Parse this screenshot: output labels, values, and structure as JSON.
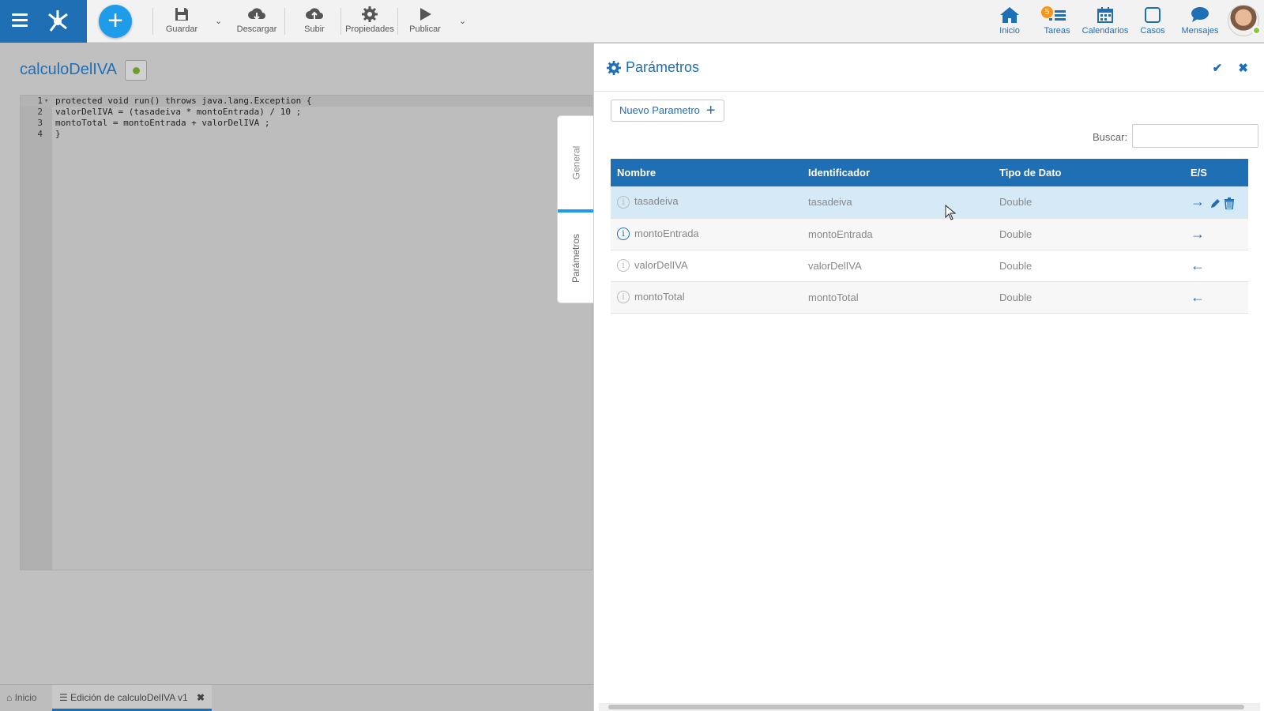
{
  "toolbar": {
    "buttons": [
      {
        "label": "Guardar",
        "icon": "save-icon"
      },
      {
        "label": "Descargar",
        "icon": "cloud-download-icon"
      },
      {
        "label": "Subir",
        "icon": "cloud-upload-icon"
      },
      {
        "label": "Propiedades",
        "icon": "gear-icon"
      },
      {
        "label": "Publicar",
        "icon": "play-icon"
      }
    ],
    "add_label": "+"
  },
  "nav": {
    "items": [
      {
        "label": "Inicio",
        "icon": "home-icon"
      },
      {
        "label": "Tareas",
        "icon": "tasks-icon",
        "badge": "5"
      },
      {
        "label": "Calendarios",
        "icon": "calendar-icon"
      },
      {
        "label": "Casos",
        "icon": "case-icon"
      },
      {
        "label": "Mensajes",
        "icon": "message-icon"
      }
    ]
  },
  "editor": {
    "title": "calculoDelIVA",
    "status_color": "#6e9e2c",
    "lines": [
      {
        "num": "1",
        "text": "protected void run() throws java.lang.Exception {"
      },
      {
        "num": "2",
        "text": "valorDelIVA = (tasadeiva * montoEntrada) / 10 ;"
      },
      {
        "num": "3",
        "text": "montoTotal = montoEntrada + valorDelIVA ;"
      },
      {
        "num": "4",
        "text": "}"
      }
    ]
  },
  "side_tabs": {
    "general": "General",
    "parametros": "Parámetros"
  },
  "bottom_tabs": {
    "home": "Inicio",
    "edit": "Edición de calculoDelIVA v1"
  },
  "panel": {
    "title": "Parámetros",
    "new_button": "Nuevo Parametro",
    "search_label": "Buscar:",
    "columns": [
      "Nombre",
      "Identificador",
      "Tipo de Dato",
      "E/S"
    ],
    "rows": [
      {
        "name": "tasadeiva",
        "id": "tasadeiva",
        "type": "Double",
        "io": "→"
      },
      {
        "name": "montoEntrada",
        "id": "montoEntrada",
        "type": "Double",
        "io": "→"
      },
      {
        "name": "valorDelIVA",
        "id": "valorDelIVA",
        "type": "Double",
        "io": "←"
      },
      {
        "name": "montoTotal",
        "id": "montoTotal",
        "type": "Double",
        "io": "←"
      }
    ]
  },
  "colors": {
    "accent": "#1f6fb5",
    "add_button": "#1e9be9",
    "badge": "#f7941d"
  }
}
